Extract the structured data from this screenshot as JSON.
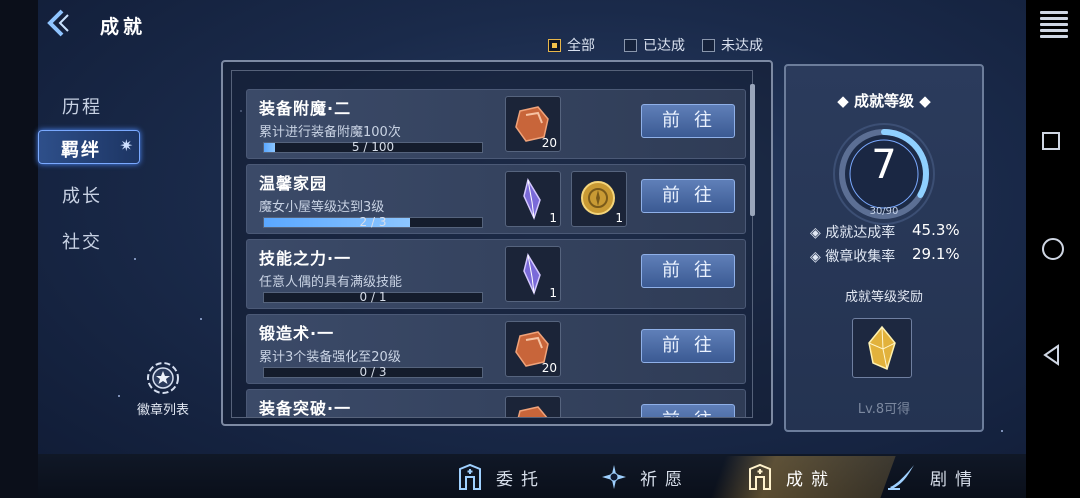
{
  "header": {
    "title": "成就"
  },
  "filters": [
    {
      "label": "全部",
      "checked": true
    },
    {
      "label": "已达成",
      "checked": false
    },
    {
      "label": "未达成",
      "checked": false
    }
  ],
  "nav": {
    "items": [
      {
        "label": "历程",
        "active": false
      },
      {
        "label": "羁绊",
        "active": true
      },
      {
        "label": "成长",
        "active": false
      },
      {
        "label": "社交",
        "active": false
      }
    ],
    "badge_list_label": "徽章列表"
  },
  "achievements": [
    {
      "name": "装备附魔·二",
      "desc": "累计进行装备附魔100次",
      "progress_text": "5 / 100",
      "progress": 0.05,
      "rewards": [
        {
          "icon": "ore-icon",
          "count": "20"
        }
      ],
      "button": "前往"
    },
    {
      "name": "温馨家园",
      "desc": "魔女小屋等级达到3级",
      "progress_text": "2 / 3",
      "progress": 0.67,
      "rewards": [
        {
          "icon": "crystal-icon",
          "count": "1"
        },
        {
          "icon": "coin-icon",
          "count": "1"
        }
      ],
      "button": "前往"
    },
    {
      "name": "技能之力·一",
      "desc": "任意人偶的具有满级技能",
      "progress_text": "0 / 1",
      "progress": 0,
      "rewards": [
        {
          "icon": "crystal-icon",
          "count": "1"
        }
      ],
      "button": "前往"
    },
    {
      "name": "锻造术·一",
      "desc": "累计3个装备强化至20级",
      "progress_text": "0 / 3",
      "progress": 0,
      "rewards": [
        {
          "icon": "ore-icon",
          "count": "20"
        }
      ],
      "button": "前往"
    },
    {
      "name": "装备突破·一",
      "desc": "",
      "progress_text": "",
      "progress": 0,
      "rewards": [
        {
          "icon": "ore-icon",
          "count": ""
        }
      ],
      "button": "前往"
    }
  ],
  "level_panel": {
    "title": "成就等级",
    "level": "7",
    "xp_text": "30/90",
    "xp_progress": 0.333,
    "stats": [
      {
        "label": "成就达成率",
        "value": "45.3%"
      },
      {
        "label": "徽章收集率",
        "value": "29.1%"
      }
    ],
    "reward_title": "成就等级奖励",
    "reward_note": "Lv.8可得"
  },
  "bottom_nav": [
    {
      "label": "委托",
      "icon": "gate-icon",
      "active": false
    },
    {
      "label": "祈愿",
      "icon": "star-burst-icon",
      "active": false
    },
    {
      "label": "成就",
      "icon": "gate-icon",
      "active": true
    },
    {
      "label": "剧情",
      "icon": "quill-icon",
      "active": false
    }
  ],
  "colors": {
    "accent": "#4f8cff",
    "gold": "#f0c04a",
    "progress": "#5aa7ff"
  }
}
